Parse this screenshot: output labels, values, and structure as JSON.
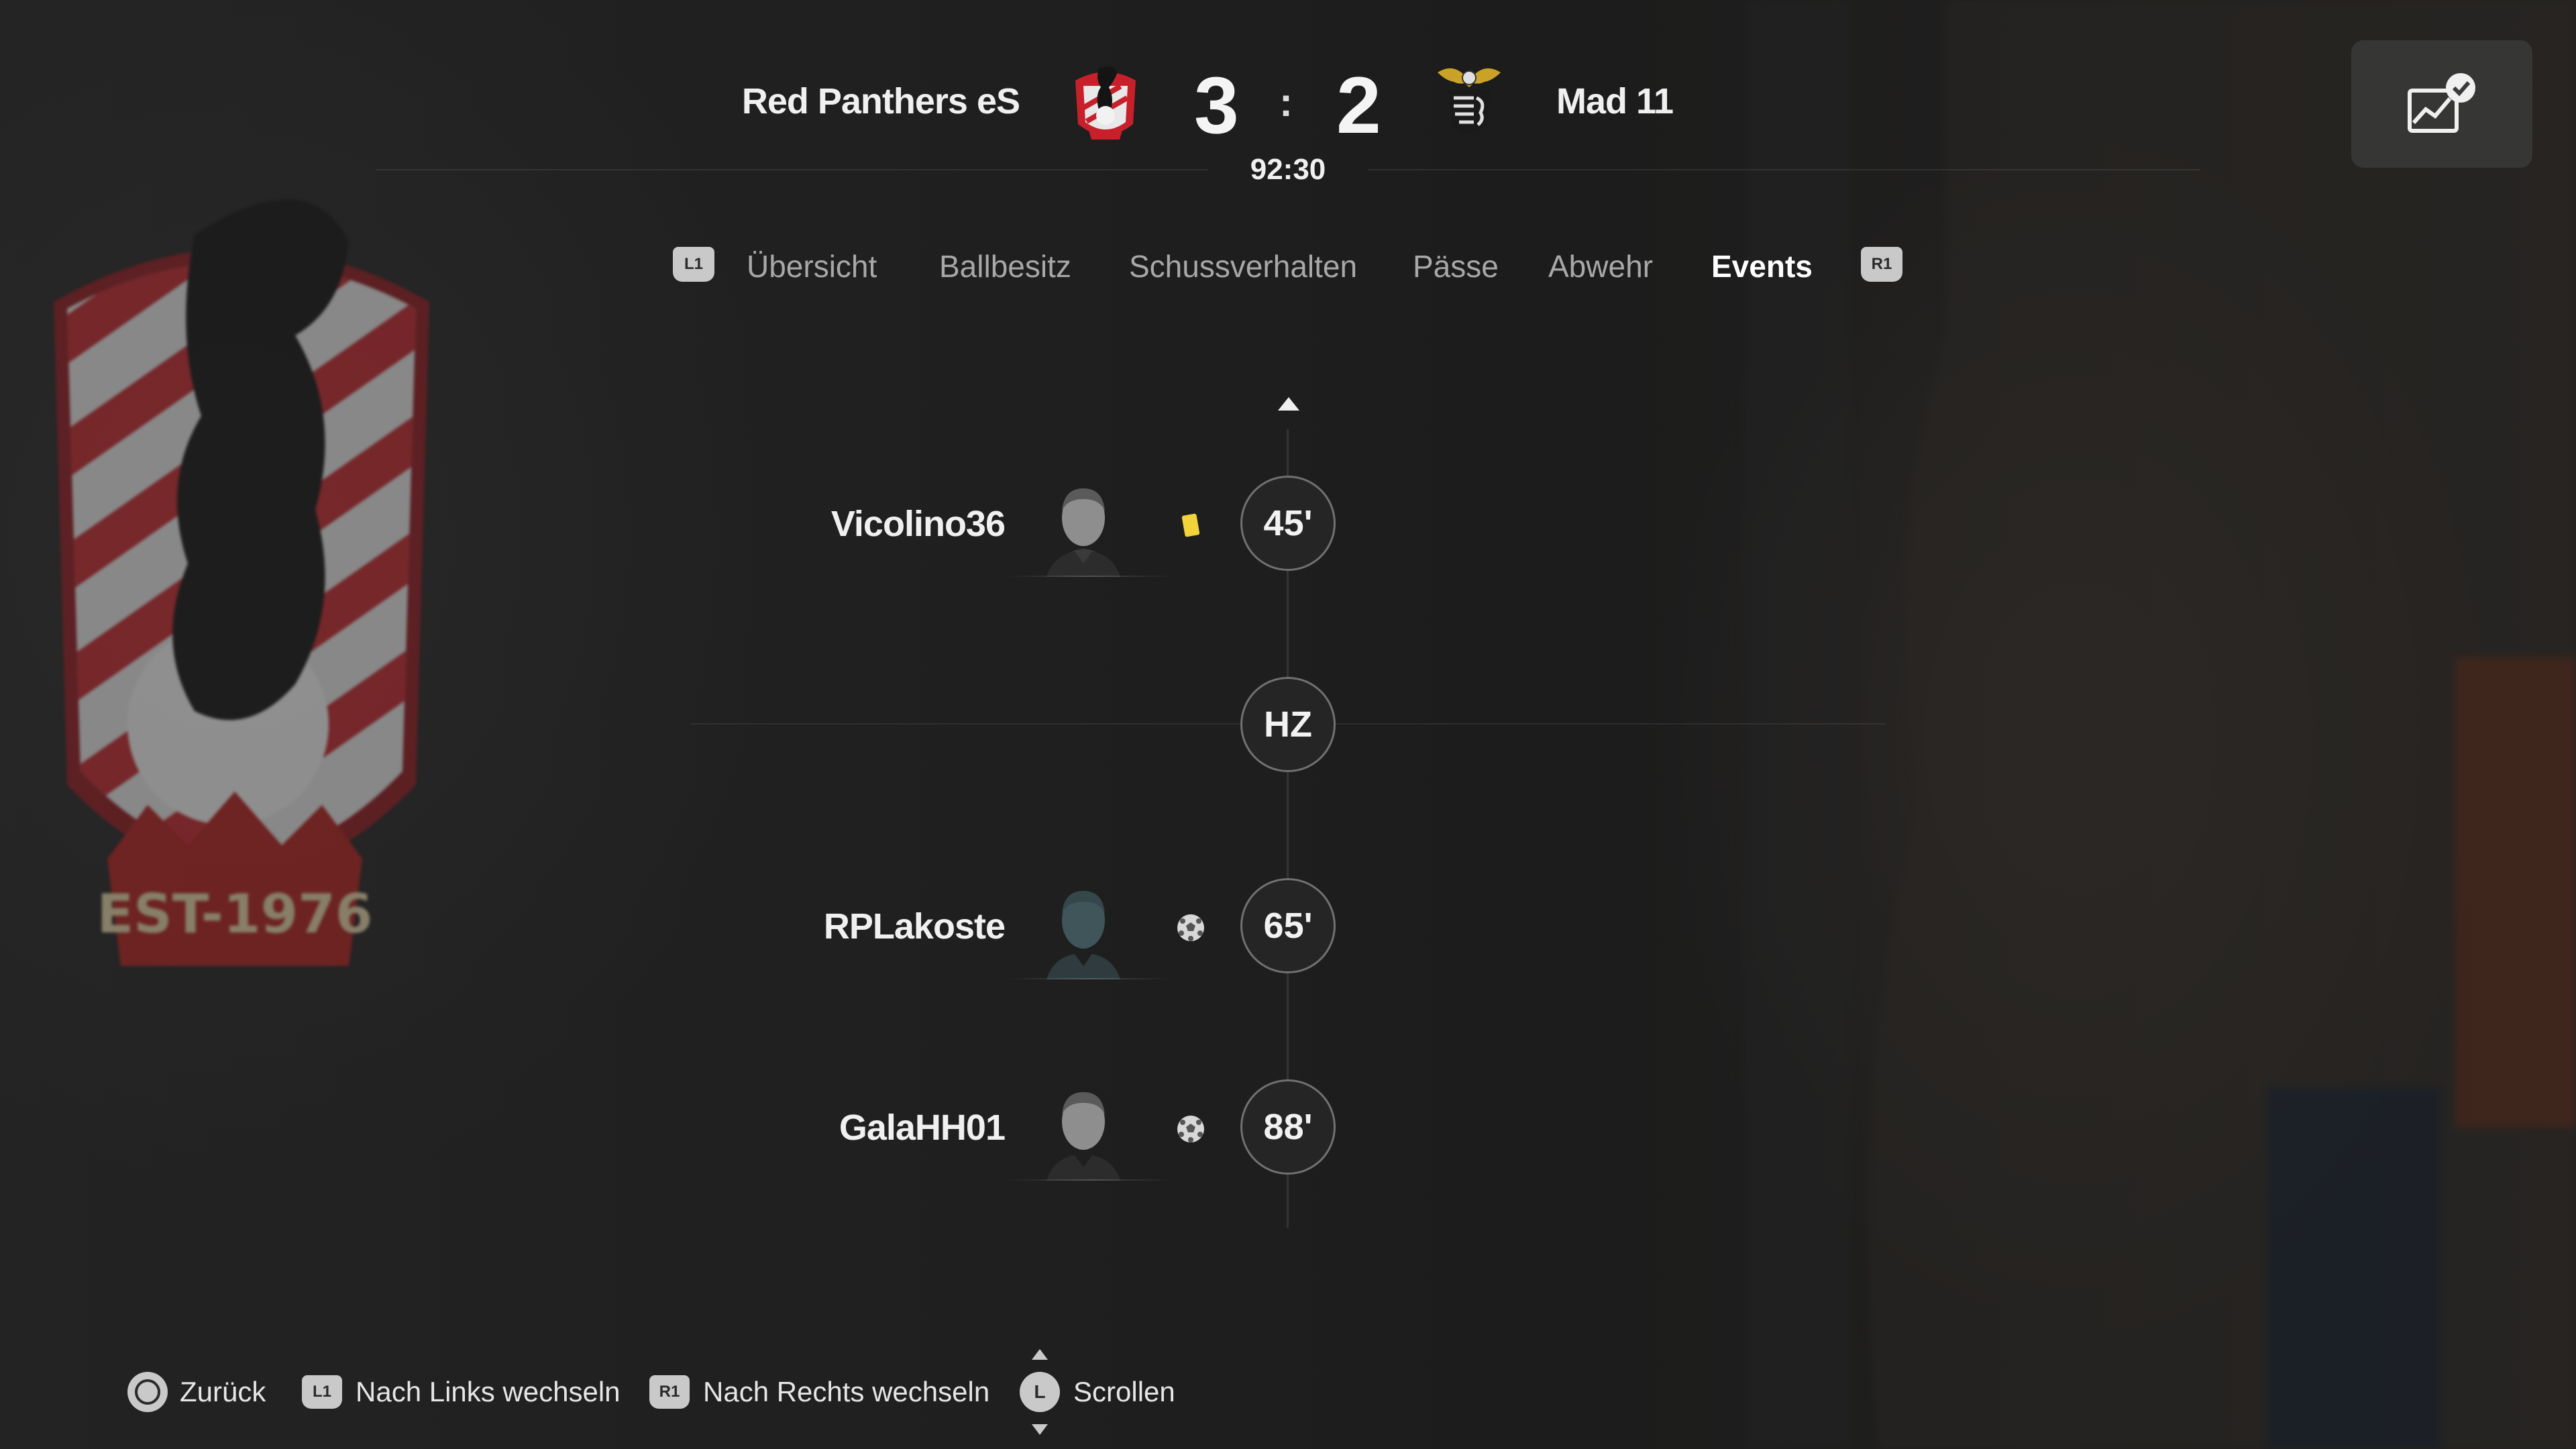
{
  "match": {
    "home_team": "Red Panthers eS",
    "away_team": "Mad 11",
    "home_score": "3",
    "away_score": "2",
    "separator": ":",
    "clock": "92:30"
  },
  "background": {
    "crest_text": "EST-1976"
  },
  "tabs": {
    "left_bumper": "L1",
    "right_bumper": "R1",
    "items": [
      {
        "label": "Übersicht",
        "active": false
      },
      {
        "label": "Ballbesitz",
        "active": false
      },
      {
        "label": "Schussverhalten",
        "active": false
      },
      {
        "label": "Pässe",
        "active": false
      },
      {
        "label": "Abwehr",
        "active": false
      },
      {
        "label": "Events",
        "active": true
      }
    ]
  },
  "events": [
    {
      "player": "Vicolino36",
      "minute": "45'",
      "type": "yellow-card-icon"
    },
    {
      "player": "RPLakoste",
      "minute": "65'",
      "type": "goal-ball-icon"
    },
    {
      "player": "GalaHH01",
      "minute": "88'",
      "type": "goal-ball-icon"
    }
  ],
  "halftime_label": "HZ",
  "colors": {
    "yellow_card": "#f2d43a",
    "home_red": "#c8202a",
    "away_gold": "#c9a227"
  },
  "footer": {
    "back_label": "Zurück",
    "left_button": "L1",
    "left_label": "Nach Links wechseln",
    "right_button": "R1",
    "right_label": "Nach Rechts wechseln",
    "scroll_button": "L",
    "scroll_label": "Scrollen"
  }
}
